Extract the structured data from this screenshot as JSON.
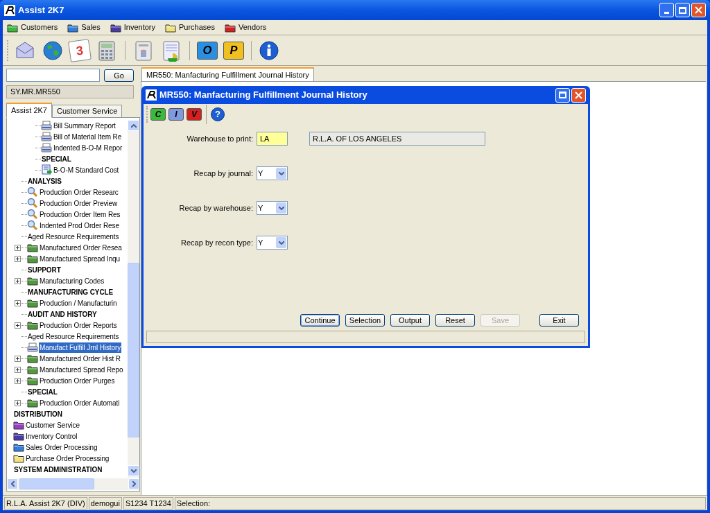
{
  "window": {
    "title": "Assist 2K7"
  },
  "menu": [
    {
      "label": "Customers",
      "color": "#3cb93c"
    },
    {
      "label": "Sales",
      "color": "#2f7fe0"
    },
    {
      "label": "Inventory",
      "color": "#4a3aa8"
    },
    {
      "label": "Purchases",
      "color": "#f2e27a"
    },
    {
      "label": "Vendors",
      "color": "#d62020"
    }
  ],
  "toolbar": [
    {
      "kind": "mail"
    },
    {
      "kind": "globe"
    },
    {
      "kind": "calendar",
      "label": "3"
    },
    {
      "kind": "calculator"
    },
    {
      "kind": "separator"
    },
    {
      "kind": "contact"
    },
    {
      "kind": "chart-sheet"
    },
    {
      "kind": "separator"
    },
    {
      "kind": "letter-folder",
      "label": "O",
      "color": "#2a8fe0"
    },
    {
      "kind": "letter-folder",
      "label": "P",
      "color": "#f0c020"
    },
    {
      "kind": "separator"
    },
    {
      "kind": "info"
    }
  ],
  "search": {
    "button": "Go"
  },
  "path": "SY.MR.MR550",
  "nav_tabs": [
    {
      "label": "Assist 2K7",
      "selected": true
    },
    {
      "label": "Customer Service",
      "selected": false
    }
  ],
  "tree": [
    {
      "children": [
        {
          "children": [
            {
              "kind": "report",
              "label": "Bill Summary Report",
              "selected": false
            },
            {
              "kind": "report",
              "label": "Bill of Material Item Re",
              "selected": false
            },
            {
              "kind": "report",
              "label": "Indented B-O-M Repor",
              "selected": false
            },
            {
              "kind": "group",
              "label": "SPECIAL",
              "selected": false
            },
            {
              "kind": "sheet",
              "label": "B-O-M Standard Cost",
              "selected": false
            }
          ]
        },
        {
          "kind": "group",
          "label": "ANALYSIS",
          "selected": false
        },
        {
          "kind": "inquiry",
          "label": "Production Order Researc",
          "selected": false
        },
        {
          "kind": "inquiry",
          "label": "Production Order Preview",
          "selected": false
        },
        {
          "kind": "inquiry",
          "label": "Production Order Item Res",
          "selected": false
        },
        {
          "kind": "inquiry",
          "label": "Indented Prod Order Rese",
          "selected": false
        },
        {
          "kind": "text",
          "label": "Aged Resource Requirements",
          "selected": false
        },
        {
          "kind": "folder",
          "label": "Manufactured Order Resea",
          "color": "#4f9a3a",
          "selected": false
        },
        {
          "kind": "folder",
          "label": "Manufactured Spread Inqu",
          "color": "#4f9a3a",
          "selected": false
        },
        {
          "kind": "group",
          "label": "SUPPORT",
          "selected": false
        },
        {
          "kind": "folder",
          "label": "Manufacturing Codes",
          "color": "#4f9a3a",
          "selected": false
        },
        {
          "kind": "group",
          "label": "MANUFACTURING CYCLE",
          "selected": false
        },
        {
          "kind": "folder",
          "label": "Production / Manufacturin",
          "color": "#4f9a3a",
          "selected": false
        },
        {
          "kind": "group",
          "label": "AUDIT AND HISTORY",
          "selected": false
        },
        {
          "kind": "folder",
          "label": "Production Order Reports",
          "color": "#4f9a3a",
          "selected": false
        },
        {
          "kind": "text",
          "label": "Aged Resource Requirements",
          "selected": false
        },
        {
          "kind": "report",
          "label": "Manufact Fulfill Jrnl History",
          "selected": true
        },
        {
          "kind": "folder",
          "label": "Manufactured Order Hist R",
          "color": "#4f9a3a",
          "selected": false
        },
        {
          "kind": "folder",
          "label": "Manufactured Spread Repo",
          "color": "#4f9a3a",
          "selected": false
        },
        {
          "kind": "folder",
          "label": "Production Order Purges",
          "color": "#4f9a3a",
          "selected": false
        },
        {
          "kind": "group",
          "label": "SPECIAL",
          "selected": false
        },
        {
          "kind": "folder",
          "label": "Production Order Automati",
          "color": "#4f9a3a",
          "selected": false
        }
      ]
    },
    {
      "kind": "group",
      "label": "DISTRIBUTION",
      "selected": false
    },
    {
      "kind": "module",
      "label": "Customer Service",
      "color": "#9a3ac8",
      "selected": false
    },
    {
      "kind": "module",
      "label": "Inventory Control",
      "color": "#4a3aa8",
      "selected": false
    },
    {
      "kind": "module",
      "label": "Sales Order Processing",
      "color": "#2f7fe0",
      "selected": false
    },
    {
      "kind": "module",
      "label": "Purchase Order Processing",
      "color": "#f2e27a",
      "selected": false
    },
    {
      "kind": "group",
      "label": "SYSTEM ADMINISTRATION",
      "selected": false
    }
  ],
  "doc_tabs": [
    {
      "label": "MR550: Manfacturing Fulfillment Journal History",
      "selected": true
    }
  ],
  "dialog": {
    "title": "MR550: Manfacturing Fulfillment Journal History",
    "toolbar": [
      {
        "kind": "letter-folder",
        "label": "C",
        "color": "#3cb93c"
      },
      {
        "kind": "letter-folder",
        "label": "I",
        "color": "#7f9ae0"
      },
      {
        "kind": "letter-folder",
        "label": "V",
        "color": "#d62020"
      },
      {
        "kind": "separator"
      },
      {
        "kind": "help",
        "label": "?"
      }
    ],
    "fields": [
      {
        "kind": "text",
        "label": "Warehouse to print:",
        "value": "LA",
        "description": "R.L.A. OF LOS ANGELES"
      },
      {
        "kind": "select",
        "label": "Recap by journal:",
        "value": "Y"
      },
      {
        "kind": "select",
        "label": "Recap by warehouse:",
        "value": "Y"
      },
      {
        "kind": "select",
        "label": "Recap by recon type:",
        "value": "Y"
      }
    ],
    "buttons": [
      {
        "label": "Continue",
        "disabled": false,
        "focused": true
      },
      {
        "label": "Selection",
        "disabled": false,
        "focused": false
      },
      {
        "label": "Output",
        "disabled": false,
        "focused": false
      },
      {
        "label": "Reset",
        "disabled": false,
        "focused": false
      },
      {
        "label": "Save",
        "disabled": true,
        "focused": false
      },
      {
        "label": "Exit",
        "disabled": false,
        "focused": false
      }
    ]
  },
  "status_bar": [
    "R.L.A. Assist 2K7 (DIV)",
    "demogui",
    "S1234 T1234",
    "Selection:"
  ]
}
